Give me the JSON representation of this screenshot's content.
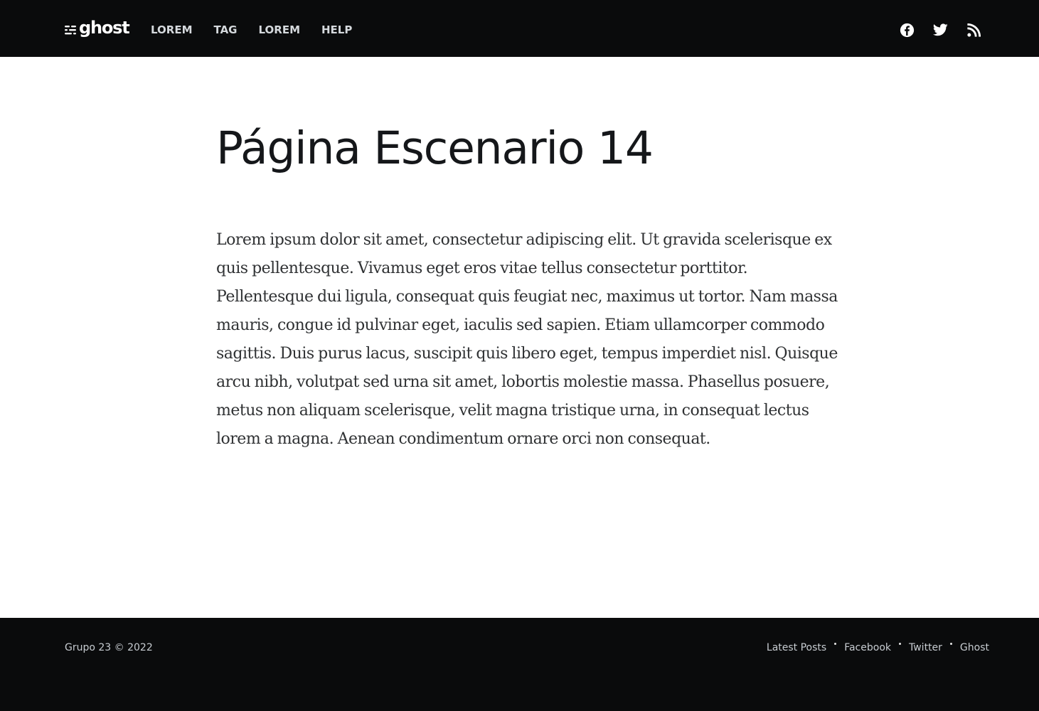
{
  "header": {
    "logo_text": "ghost",
    "nav_items": [
      "LOREM",
      "TAG",
      "LOREM",
      "HELP"
    ],
    "social_icons": [
      "facebook-icon",
      "twitter-icon",
      "rss-icon"
    ]
  },
  "main": {
    "title": "Página Escenario 14",
    "body": "Lorem ipsum dolor sit amet, consectetur adipiscing elit. Ut gravida scelerisque ex quis pellentesque. Vivamus eget eros vitae tellus consectetur porttitor. Pellentesque dui ligula, consequat quis feugiat nec, maximus ut tortor. Nam massa mauris, congue id pulvinar eget, iaculis sed sapien. Etiam ullamcorper commodo sagittis. Duis purus lacus, suscipit quis libero eget, tempus imperdiet nisl. Quisque arcu nibh, volutpat sed urna sit amet, lobortis molestie massa. Phasellus posuere, metus non aliquam scelerisque, velit magna tristique urna, in consequat lectus lorem a magna. Aenean condimentum ornare orci non consequat."
  },
  "footer": {
    "copyright": "Grupo 23 © 2022",
    "links": [
      "Latest Posts",
      "Facebook",
      "Twitter",
      "Ghost"
    ]
  },
  "colors": {
    "bar_background": "#0a0b0c",
    "title_text": "#15171a",
    "body_text": "#2f3133"
  }
}
